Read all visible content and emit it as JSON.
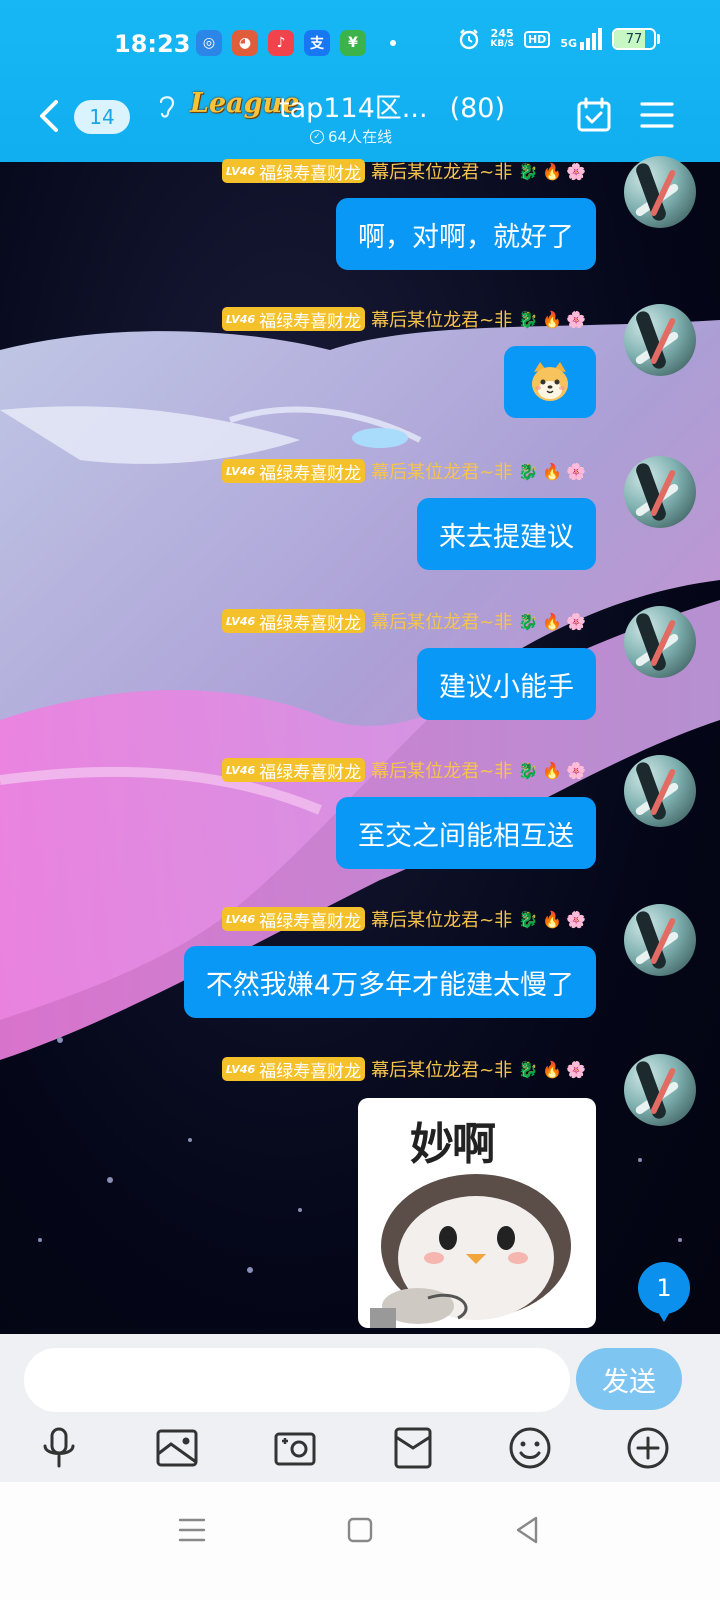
{
  "status": {
    "time": "18:23",
    "net_speed_value": "245",
    "net_speed_unit": "KB/S",
    "hd": "HD",
    "network": "5G",
    "battery": "77",
    "battery_level": 0.77,
    "apps": [
      {
        "name": "browser-app-icon",
        "glyph": "◎",
        "color": "#2c86e8"
      },
      {
        "name": "game-app-icon",
        "glyph": "◕",
        "color": "#e05d3c"
      },
      {
        "name": "music-app-icon",
        "glyph": "♪",
        "color": "#f2434c"
      },
      {
        "name": "alipay-app-icon",
        "glyph": "支",
        "color": "#1877f2"
      },
      {
        "name": "wechat-pay-app-icon",
        "glyph": "¥",
        "color": "#3cb34a"
      }
    ]
  },
  "header": {
    "back_count": "14",
    "logo": "League",
    "title": "tap114区...",
    "member_count": "(80)",
    "online": "64人在线"
  },
  "messages": [
    {
      "level": "LV46",
      "title": "福绿寿喜财龙",
      "nick": "幕后某位龙君~非",
      "text": "啊，对啊，就好了",
      "type": "text"
    },
    {
      "level": "LV46",
      "title": "福绿寿喜财龙",
      "nick": "幕后某位龙君~非",
      "text": "",
      "type": "emoji"
    },
    {
      "level": "LV46",
      "title": "福绿寿喜财龙",
      "nick": "幕后某位龙君~非",
      "text": "来去提建议",
      "type": "text"
    },
    {
      "level": "LV46",
      "title": "福绿寿喜财龙",
      "nick": "幕后某位龙君~非",
      "text": "建议小能手",
      "type": "text"
    },
    {
      "level": "LV46",
      "title": "福绿寿喜财龙",
      "nick": "幕后某位龙君~非",
      "text": "至交之间能相互送",
      "type": "text"
    },
    {
      "level": "LV46",
      "title": "福绿寿喜财龙",
      "nick": "幕后某位龙君~非",
      "text": "不然我嫌4万多年才能建太慢了",
      "type": "text"
    },
    {
      "level": "LV46",
      "title": "福绿寿喜财龙",
      "nick": "幕后某位龙君~非",
      "sticker_text": "妙啊",
      "type": "sticker"
    }
  ],
  "unread_badge": "1",
  "composer": {
    "placeholder": "",
    "send_label": "发送"
  },
  "toolbar": [
    "voice-icon",
    "image-icon",
    "camera-icon",
    "red-packet-icon",
    "emoji-icon",
    "plus-icon"
  ]
}
